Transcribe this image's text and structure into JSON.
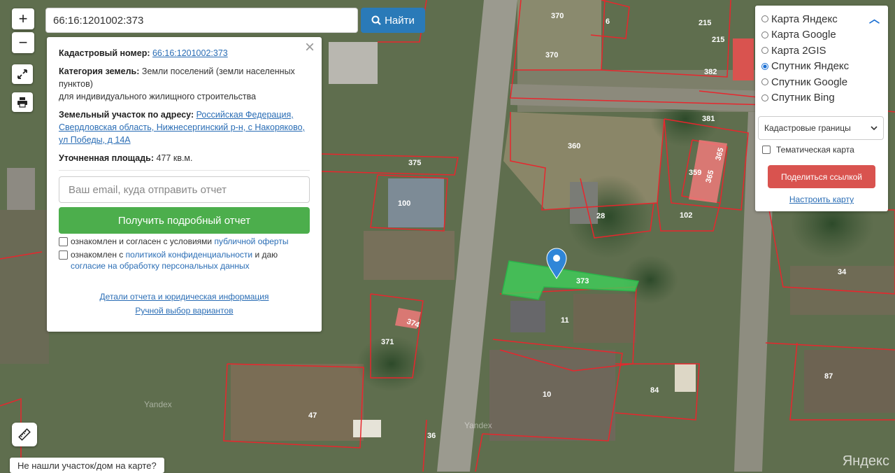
{
  "search": {
    "value": "66:16:1201002:373",
    "button_label": "Найти"
  },
  "controls": {
    "zoom_in": "+",
    "zoom_out": "−"
  },
  "info": {
    "cadastral_label": "Кадастровый номер:",
    "cadastral_value": "66:16:1201002:373",
    "category_label": "Категория земель:",
    "category_value": "Земли поселений (земли населенных пунктов)",
    "category_use": "для индивидуального жилищного строительства",
    "address_label": "Земельный участок по адресу:",
    "address_value": "Российская Федерация, Свердловская область, Нижнесергинский р-н, с Накоряково, ул Победы, д 14А",
    "area_label": "Уточненная площадь:",
    "area_value": "477 кв.м.",
    "email_placeholder": "Ваш email, куда отправить отчет",
    "report_button": "Получить подробный отчет",
    "consent1_text": "ознакомлен и согласен с условиями",
    "consent1_link": "публичной оферты",
    "consent2_text": "ознакомлен с",
    "consent2_link": "политикой конфиденциальности",
    "consent2_mid": "и даю",
    "consent2_link2": "согласие на обработку персональных данных",
    "details_link": "Детали отчета и юридическая информация",
    "manual_link": "Ручной выбор вариантов"
  },
  "layers": {
    "options": [
      "Карта Яндекс",
      "Карта Google",
      "Карта 2GIS",
      "Спутник Яндекс",
      "Спутник Google",
      "Спутник Bing"
    ],
    "selected": "Спутник Яндекс",
    "overlay_select": "Кадастровые границы",
    "thematic_label": "Тематическая карта",
    "share_button": "Поделиться ссылкой",
    "configure_link": "Настроить карту"
  },
  "parcels": [
    "370",
    "6",
    "215",
    "215",
    "370",
    "382",
    "381",
    "360",
    "365",
    "365",
    "359",
    "28",
    "102",
    "375",
    "100",
    "373",
    "11",
    "374",
    "371",
    "34",
    "10",
    "84",
    "87",
    "47",
    "36"
  ],
  "not_found": "Не нашли участок/дом на карте?",
  "watermarks": {
    "yandex_corner": "Яндекс",
    "yandex_faint": "Yandex"
  },
  "colors": {
    "boundary": "#e8262d",
    "selected_parcel": "#3ed05a",
    "marker": "#2f86d8",
    "search_button": "#2a7ab8",
    "report_button": "#4cae4c",
    "share_button": "#d9534f"
  }
}
